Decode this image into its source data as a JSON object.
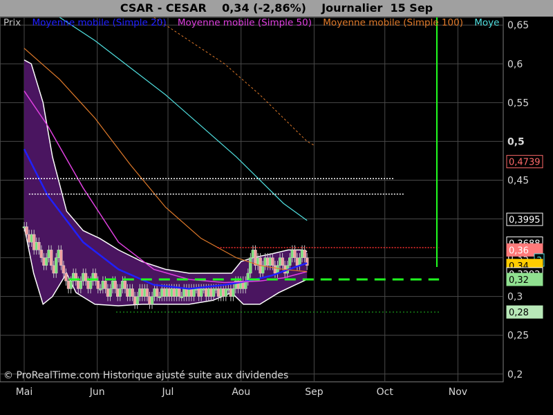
{
  "title": {
    "symbol": "CSAR - CESAR",
    "quote": "0,34 (-2,86%)",
    "period": "Journalier",
    "date": "15 Sep"
  },
  "legend": [
    {
      "label": "Prix",
      "color": "#c0c0c0"
    },
    {
      "label": "Moyenne mobile (Simple 20)",
      "color": "#2020ff"
    },
    {
      "label": "Moyenne mobile (Simple 50)",
      "color": "#e040e0"
    },
    {
      "label": "Moyenne mobile (Simple 100)",
      "color": "#e07a2a"
    },
    {
      "label": "Moye",
      "color": "#50e0e0"
    }
  ],
  "credit": "© ProRealTime.com Historique ajusté suite aux dividendes",
  "chart_data": {
    "type": "line",
    "x_ticks": [
      "Mai",
      "Jun",
      "Jul",
      "Aou",
      "Sep",
      "Oct",
      "Nov"
    ],
    "y_ticks": [
      "0,65",
      "0,6",
      "0,55",
      "0,5",
      "0,45",
      "0,4",
      "0,35",
      "0,3",
      "0,25",
      "0,2"
    ],
    "y_tick_values": [
      0.65,
      0.6,
      0.55,
      0.5,
      0.45,
      0.4,
      0.35,
      0.3,
      0.25,
      0.2
    ],
    "y_bold_tick": "0,5",
    "ylim": [
      0.19,
      0.66
    ],
    "x_day_range": [
      0,
      210
    ],
    "x_tick_days": [
      0,
      31,
      61,
      92,
      123,
      153,
      184
    ],
    "grid": true,
    "price_closes": [
      0.39,
      0.38,
      0.37,
      0.38,
      0.36,
      0.37,
      0.36,
      0.35,
      0.34,
      0.35,
      0.36,
      0.34,
      0.33,
      0.35,
      0.36,
      0.34,
      0.33,
      0.32,
      0.31,
      0.32,
      0.33,
      0.32,
      0.31,
      0.32,
      0.33,
      0.32,
      0.31,
      0.32,
      0.33,
      0.32,
      0.31,
      0.31,
      0.32,
      0.31,
      0.3,
      0.31,
      0.32,
      0.31,
      0.3,
      0.31,
      0.32,
      0.31,
      0.3,
      0.31,
      0.3,
      0.29,
      0.3,
      0.31,
      0.3,
      0.31,
      0.3,
      0.29,
      0.3,
      0.31,
      0.3,
      0.3,
      0.31,
      0.3,
      0.31,
      0.3,
      0.31,
      0.3,
      0.31,
      0.3,
      0.3,
      0.31,
      0.3,
      0.31,
      0.3,
      0.31,
      0.31,
      0.3,
      0.31,
      0.31,
      0.3,
      0.31,
      0.3,
      0.31,
      0.31,
      0.3,
      0.31,
      0.3,
      0.31,
      0.31,
      0.3,
      0.31,
      0.32,
      0.31,
      0.32,
      0.31,
      0.32,
      0.33,
      0.35,
      0.36,
      0.34,
      0.35,
      0.33,
      0.34,
      0.35,
      0.34,
      0.35,
      0.34,
      0.33,
      0.34,
      0.35,
      0.34,
      0.33,
      0.34,
      0.35,
      0.36,
      0.35,
      0.34,
      0.35,
      0.36,
      0.35,
      0.34
    ],
    "series": [
      {
        "name": "Moyenne mobile (Simple 20)",
        "color": "#2020ff",
        "width": 2.5,
        "points": [
          [
            0,
            0.49
          ],
          [
            10,
            0.43
          ],
          [
            25,
            0.37
          ],
          [
            40,
            0.335
          ],
          [
            55,
            0.315
          ],
          [
            70,
            0.31
          ],
          [
            85,
            0.315
          ],
          [
            95,
            0.32
          ],
          [
            105,
            0.327
          ],
          [
            115,
            0.338
          ],
          [
            120,
            0.343
          ]
        ]
      },
      {
        "name": "Moyenne mobile (Simple 50)",
        "color": "#e040e0",
        "width": 1.5,
        "points": [
          [
            0,
            0.565
          ],
          [
            10,
            0.52
          ],
          [
            25,
            0.44
          ],
          [
            40,
            0.37
          ],
          [
            55,
            0.335
          ],
          [
            70,
            0.322
          ],
          [
            85,
            0.318
          ],
          [
            100,
            0.32
          ],
          [
            110,
            0.324
          ],
          [
            120,
            0.332
          ]
        ]
      },
      {
        "name": "Moyenne mobile (Simple 100)",
        "color": "#e07a2a",
        "width": 1.2,
        "points": [
          [
            0,
            0.62
          ],
          [
            15,
            0.58
          ],
          [
            30,
            0.53
          ],
          [
            45,
            0.47
          ],
          [
            60,
            0.415
          ],
          [
            75,
            0.375
          ],
          [
            90,
            0.35
          ],
          [
            100,
            0.34
          ],
          [
            110,
            0.335
          ],
          [
            120,
            0.332
          ]
        ]
      },
      {
        "name": "Moye",
        "color": "#50e0e0",
        "width": 1.2,
        "points": [
          [
            15,
            0.66
          ],
          [
            30,
            0.63
          ],
          [
            45,
            0.595
          ],
          [
            60,
            0.56
          ],
          [
            75,
            0.52
          ],
          [
            90,
            0.48
          ],
          [
            100,
            0.45
          ],
          [
            110,
            0.42
          ],
          [
            120,
            0.398
          ]
        ]
      },
      {
        "name": "",
        "color": "#e07a2a",
        "width": 1,
        "dash": "3,3",
        "points": [
          [
            55,
            0.66
          ],
          [
            70,
            0.63
          ],
          [
            85,
            0.6
          ],
          [
            100,
            0.56
          ],
          [
            110,
            0.53
          ],
          [
            120,
            0.5
          ],
          [
            123,
            0.495
          ]
        ]
      }
    ],
    "bollinger": {
      "fill": "#4a1560",
      "upper": [
        [
          0,
          0.605
        ],
        [
          3,
          0.6
        ],
        [
          8,
          0.55
        ],
        [
          12,
          0.48
        ],
        [
          18,
          0.41
        ],
        [
          25,
          0.385
        ],
        [
          32,
          0.375
        ],
        [
          40,
          0.36
        ],
        [
          50,
          0.345
        ],
        [
          60,
          0.335
        ],
        [
          70,
          0.33
        ],
        [
          80,
          0.33
        ],
        [
          88,
          0.33
        ],
        [
          92,
          0.345
        ],
        [
          97,
          0.35
        ],
        [
          105,
          0.355
        ],
        [
          112,
          0.36
        ],
        [
          118,
          0.36
        ],
        [
          120,
          0.358
        ]
      ],
      "lower": [
        [
          0,
          0.39
        ],
        [
          4,
          0.33
        ],
        [
          8,
          0.29
        ],
        [
          12,
          0.3
        ],
        [
          18,
          0.33
        ],
        [
          22,
          0.305
        ],
        [
          30,
          0.29
        ],
        [
          40,
          0.288
        ],
        [
          50,
          0.29
        ],
        [
          60,
          0.29
        ],
        [
          70,
          0.29
        ],
        [
          80,
          0.295
        ],
        [
          88,
          0.305
        ],
        [
          93,
          0.29
        ],
        [
          100,
          0.29
        ],
        [
          108,
          0.305
        ],
        [
          115,
          0.315
        ],
        [
          120,
          0.322
        ]
      ]
    },
    "hlines": [
      {
        "value": 0.452,
        "from_day": 0,
        "to_day": 157,
        "color": "#ffffff",
        "dash": "2,2",
        "width": 1.5
      },
      {
        "value": 0.432,
        "from_day": 2,
        "to_day": 161,
        "color": "#ffffff",
        "dash": "2,2",
        "width": 1.5
      },
      {
        "value": 0.363,
        "from_day": 82,
        "to_day": 176,
        "color": "#ff3030",
        "dash": "2,2",
        "width": 1.5
      },
      {
        "value": 0.322,
        "from_day": 19,
        "to_day": 176,
        "color": "#20ff20",
        "dash": "16,10",
        "width": 3
      },
      {
        "value": 0.28,
        "from_day": 39,
        "to_day": 176,
        "color": "#20c020",
        "dash": "2,3",
        "width": 1
      }
    ],
    "vline": {
      "day": 153,
      "from": 0.338,
      "to": 0.66,
      "color": "#20ff20"
    },
    "badges": [
      {
        "text": "0,4739",
        "value": 0.4739,
        "bg": "#000000",
        "fg": "#ff6a6a",
        "border": "#ff6a6a"
      },
      {
        "text": "0,3995",
        "value": 0.3995,
        "bg": "#000000",
        "fg": "#ffffff",
        "border": "#ffffff"
      },
      {
        "text": "0,3688",
        "value": 0.3688,
        "bg": "#000000",
        "fg": "#ffffff",
        "border": "#ffffff"
      },
      {
        "text": "0,36",
        "value": 0.36,
        "bg": "#ff7a7a",
        "fg": "#ffffff",
        "border": "#ff7a7a"
      },
      {
        "text": "3",
        "value": 0.347,
        "bg": "#000000",
        "fg": "#50e0e0",
        "border": "#50e0e0"
      },
      {
        "text": "0,34",
        "value": 0.34,
        "bg": "#ffcc00",
        "fg": "#000000",
        "border": "#ffcc00"
      },
      {
        "text": "0,3292",
        "value": 0.3292,
        "bg": "#000000",
        "fg": "#ffffff",
        "border": "#ffffff"
      },
      {
        "text": "0,32",
        "value": 0.322,
        "bg": "#90e090",
        "fg": "#000000",
        "border": "#90e090"
      },
      {
        "text": "0,28",
        "value": 0.28,
        "bg": "#b8e8b8",
        "fg": "#000000",
        "border": "#b8e8b8"
      }
    ]
  }
}
